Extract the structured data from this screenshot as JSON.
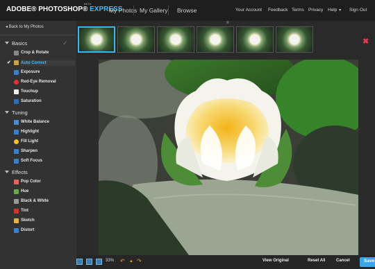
{
  "header": {
    "brand": "ADOBE® PHOTOSHOP®",
    "brand_accent": "EXPRESS",
    "beta": "BETA",
    "nav": [
      "My Photos",
      "My Gallery",
      "Browse"
    ],
    "top_links": [
      "Your Account",
      "Feedback",
      "Terms",
      "Privacy",
      "Help",
      "Sign Out"
    ]
  },
  "sidebar": {
    "back_label": "Back to My Photos",
    "sections": [
      {
        "title": "Basics",
        "items": [
          "Crop & Rotate",
          "Auto Correct",
          "Exposure",
          "Red-Eye Removal",
          "Touchup",
          "Saturation"
        ]
      },
      {
        "title": "Tuning",
        "items": [
          "White Balance",
          "Highlight",
          "Fill Light",
          "Sharpen",
          "Soft Focus"
        ]
      },
      {
        "title": "Effects",
        "items": [
          "Pop Color",
          "Hue",
          "Black & White",
          "Tint",
          "Sketch",
          "Distort"
        ]
      }
    ],
    "active_item": "Auto Correct"
  },
  "toolbar": {
    "zoom": "33%",
    "view_original": "View Original",
    "reset_all": "Reset All",
    "cancel": "Cancel",
    "save": "Save"
  },
  "colors": {
    "accent": "#3bb6f0",
    "close": "#e23b4b"
  }
}
